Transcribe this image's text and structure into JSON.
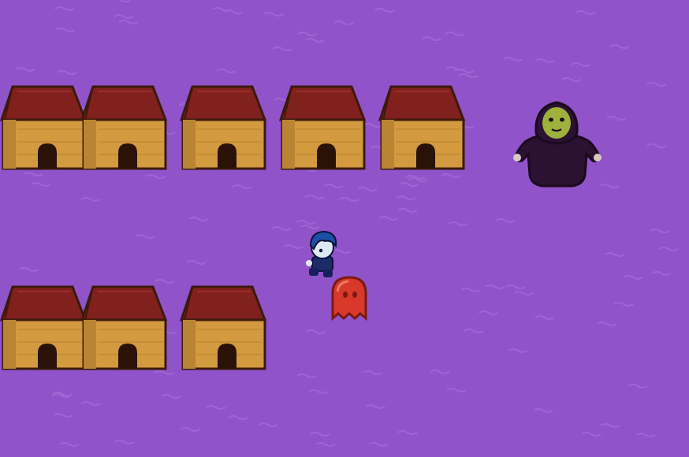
{
  "scene": {
    "background_color": "#9153c9",
    "ripple_color": "#a46ad6",
    "house_roof_color": "#80211e",
    "house_wall_color": "#d39a3f",
    "house_door_color": "#2a1208",
    "house_outline_color": "#3b1a0c",
    "hooded_robe_color": "#2b1132",
    "hooded_face_color": "#9eb13a",
    "hero_hair_color": "#1d4fa8",
    "ghost_color": "#d8392b"
  },
  "sprites": {
    "houses_top_row": [
      "house",
      "house",
      "house",
      "house",
      "house"
    ],
    "houses_bottom_row": [
      "house",
      "house",
      "house"
    ],
    "npc": "hooded-figure-icon",
    "player": "blue-haired-hero-icon",
    "follower": "red-ghost-icon"
  }
}
